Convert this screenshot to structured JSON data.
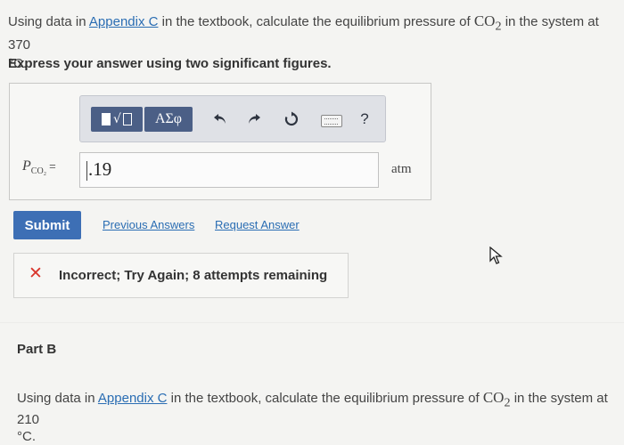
{
  "question": {
    "prefix": "Using data in ",
    "link": "Appendix C",
    "middle": " in the textbook, calculate the equilibrium pressure of ",
    "chem_base": "CO",
    "chem_sub": "2",
    "suffix": " in the system at 370",
    "unit_line": "°C."
  },
  "instruction": "Express your answer using two significant figures.",
  "toolbar": {
    "templates_icon": "templates-icon",
    "symbols_label": "ΑΣφ",
    "undo_icon": "undo-icon",
    "redo_icon": "redo-icon",
    "reset_icon": "reset-icon",
    "keyboard_icon": "keyboard-icon",
    "help_label": "?"
  },
  "answer": {
    "variable": "P",
    "variable_sub": "CO₂",
    "equals": "=",
    "value": ".19",
    "unit": "atm"
  },
  "actions": {
    "submit_label": "Submit",
    "previous_answers_label": "Previous Answers",
    "request_answer_label": "Request Answer"
  },
  "feedback": {
    "icon": "x-icon",
    "text": "Incorrect; Try Again; 8 attempts remaining",
    "color": "#d9362c"
  },
  "part_b": {
    "label": "Part B",
    "prefix": "Using data in ",
    "link": "Appendix C",
    "middle": " in the textbook, calculate the equilibrium pressure of ",
    "chem_base": "CO",
    "chem_sub": "2",
    "suffix": " in the system at 210",
    "unit_line": "°C."
  },
  "colors": {
    "accent": "#3d6fb5",
    "toolbar_button": "#4b5f86",
    "link": "#2a6db3"
  }
}
